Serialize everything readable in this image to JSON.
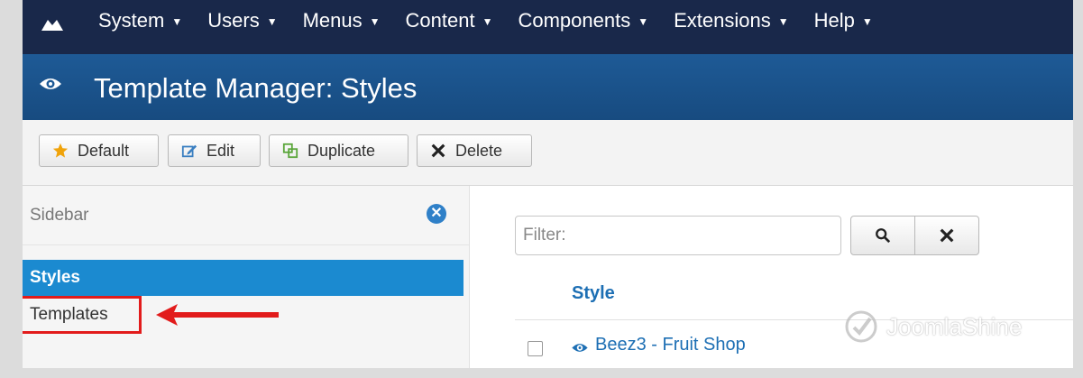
{
  "nav": {
    "items": [
      {
        "label": "System"
      },
      {
        "label": "Users"
      },
      {
        "label": "Menus"
      },
      {
        "label": "Content"
      },
      {
        "label": "Components"
      },
      {
        "label": "Extensions"
      },
      {
        "label": "Help"
      }
    ]
  },
  "header": {
    "title": "Template Manager: Styles"
  },
  "toolbar": {
    "default_label": "Default",
    "edit_label": "Edit",
    "duplicate_label": "Duplicate",
    "delete_label": "Delete"
  },
  "sidebar": {
    "heading": "Sidebar",
    "items": [
      {
        "label": "Styles",
        "active": true
      },
      {
        "label": "Templates",
        "active": false
      }
    ]
  },
  "main": {
    "filter_placeholder": "Filter:",
    "column_header": "Style",
    "rows": [
      {
        "name": "Beez3 - Fruit Shop"
      }
    ]
  },
  "watermark": {
    "text": "JoomlaShine"
  },
  "colors": {
    "nav_bg": "#19284a",
    "title_bg": "#1e5a96",
    "active_item": "#1b8ad0",
    "link": "#1d6fb4",
    "highlight": "#e21b1b"
  }
}
